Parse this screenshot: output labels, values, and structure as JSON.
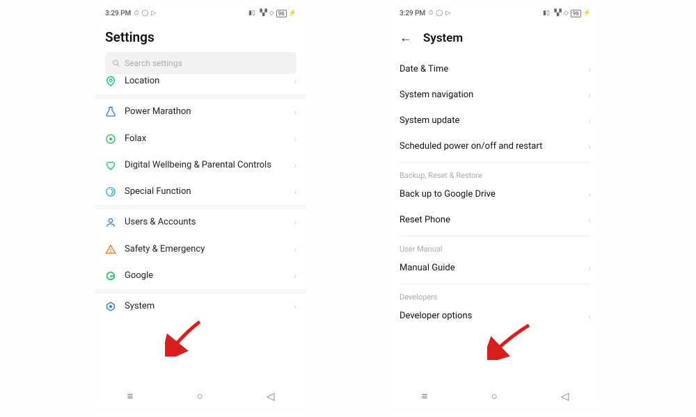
{
  "status": {
    "time": "3:29 PM",
    "battery": "96"
  },
  "left": {
    "title": "Settings",
    "search_placeholder": "Search settings",
    "items": [
      {
        "label": "Location"
      },
      {
        "label": "Power Marathon"
      },
      {
        "label": "Folax"
      },
      {
        "label": "Digital Wellbeing & Parental Controls"
      },
      {
        "label": "Special Function"
      },
      {
        "label": "Users & Accounts"
      },
      {
        "label": "Safety & Emergency"
      },
      {
        "label": "Google"
      },
      {
        "label": "System"
      }
    ]
  },
  "right": {
    "title": "System",
    "sections": [
      {
        "header": null,
        "items": [
          {
            "label": "Date & Time"
          },
          {
            "label": "System navigation"
          },
          {
            "label": "System update"
          },
          {
            "label": "Scheduled power on/off and restart"
          }
        ]
      },
      {
        "header": "Backup, Reset & Restore",
        "items": [
          {
            "label": "Back up to Google Drive"
          },
          {
            "label": "Reset Phone"
          }
        ]
      },
      {
        "header": "User Manual",
        "items": [
          {
            "label": "Manual Guide"
          }
        ]
      },
      {
        "header": "Developers",
        "items": [
          {
            "label": "Developer options"
          }
        ]
      }
    ]
  }
}
